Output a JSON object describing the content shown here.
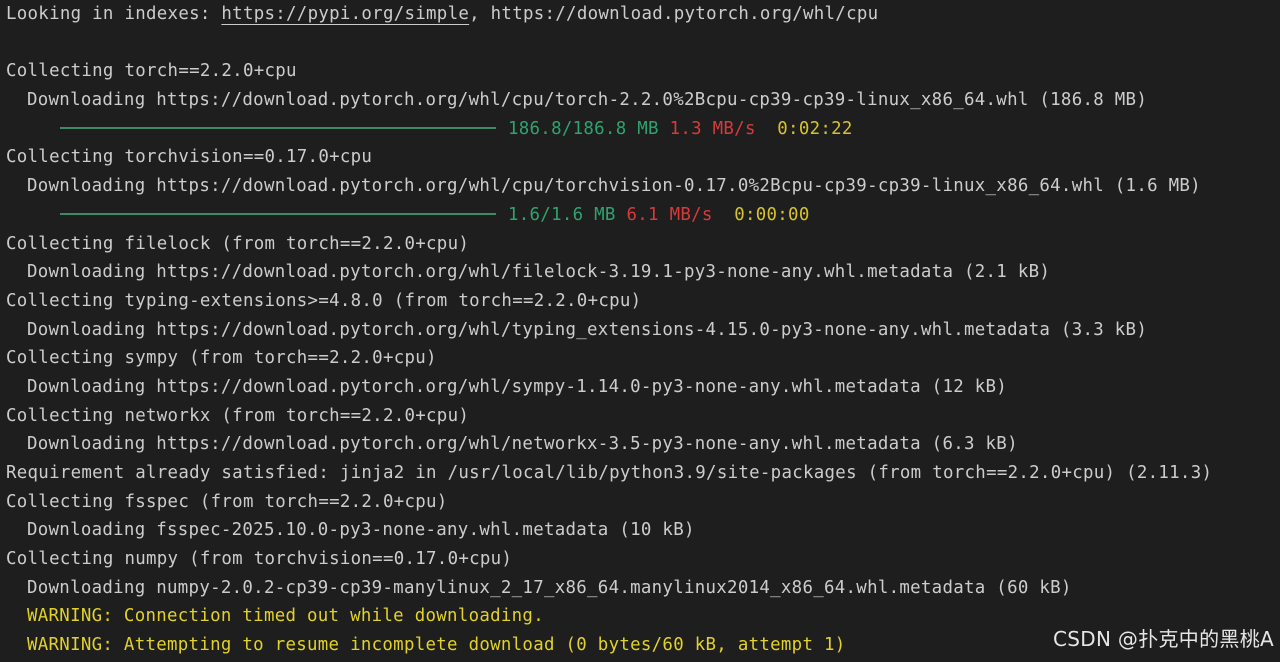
{
  "lines": {
    "l0_prefix": "Looking in indexes: ",
    "l0_link1": "https://pypi.org/simple",
    "l0_rest": ", https://download.pytorch.org/whl/cpu",
    "l1": "Collecting torch==2.2.0+cpu",
    "l2": "Downloading https://download.pytorch.org/whl/cpu/torch-2.2.0%2Bcpu-cp39-cp39-linux_x86_64.whl (186.8 MB)",
    "l3_size": "186.8/186.8 MB",
    "l3_speed": "1.3 MB/s",
    "l3_eta": "0:02:22",
    "l4": "Collecting torchvision==0.17.0+cpu",
    "l5": "Downloading https://download.pytorch.org/whl/cpu/torchvision-0.17.0%2Bcpu-cp39-cp39-linux_x86_64.whl (1.6 MB)",
    "l6_size": "1.6/1.6 MB",
    "l6_speed": "6.1 MB/s",
    "l6_eta": "0:00:00",
    "l7": "Collecting filelock (from torch==2.2.0+cpu)",
    "l8": "Downloading https://download.pytorch.org/whl/filelock-3.19.1-py3-none-any.whl.metadata (2.1 kB)",
    "l9": "Collecting typing-extensions>=4.8.0 (from torch==2.2.0+cpu)",
    "l10": "Downloading https://download.pytorch.org/whl/typing_extensions-4.15.0-py3-none-any.whl.metadata (3.3 kB)",
    "l11": "Collecting sympy (from torch==2.2.0+cpu)",
    "l12": "Downloading https://download.pytorch.org/whl/sympy-1.14.0-py3-none-any.whl.metadata (12 kB)",
    "l13": "Collecting networkx (from torch==2.2.0+cpu)",
    "l14": "Downloading https://download.pytorch.org/whl/networkx-3.5-py3-none-any.whl.metadata (6.3 kB)",
    "l15": "Requirement already satisfied: jinja2 in /usr/local/lib/python3.9/site-packages (from torch==2.2.0+cpu) (2.11.3)",
    "l16": "Collecting fsspec (from torch==2.2.0+cpu)",
    "l17": "Downloading fsspec-2025.10.0-py3-none-any.whl.metadata (10 kB)",
    "l18": "Collecting numpy (from torchvision==0.17.0+cpu)",
    "l19": "Downloading numpy-2.0.2-cp39-cp39-manylinux_2_17_x86_64.manylinux2014_x86_64.whl.metadata (60 kB)",
    "l20": "WARNING: Connection timed out while downloading.",
    "l21": "WARNING: Attempting to resume incomplete download (0 bytes/60 kB, attempt 1)"
  },
  "progress": {
    "torch": 1.0,
    "torchvision": 1.0
  },
  "colors": {
    "background": "#1e1e1e",
    "text": "#cccccc",
    "progress_bar": "#3c8a66",
    "size": "#2ea36f",
    "speed": "#d73a3a",
    "eta": "#d6c22f",
    "warning": "#e1d12a"
  },
  "watermark": "CSDN @扑克中的黑桃A"
}
